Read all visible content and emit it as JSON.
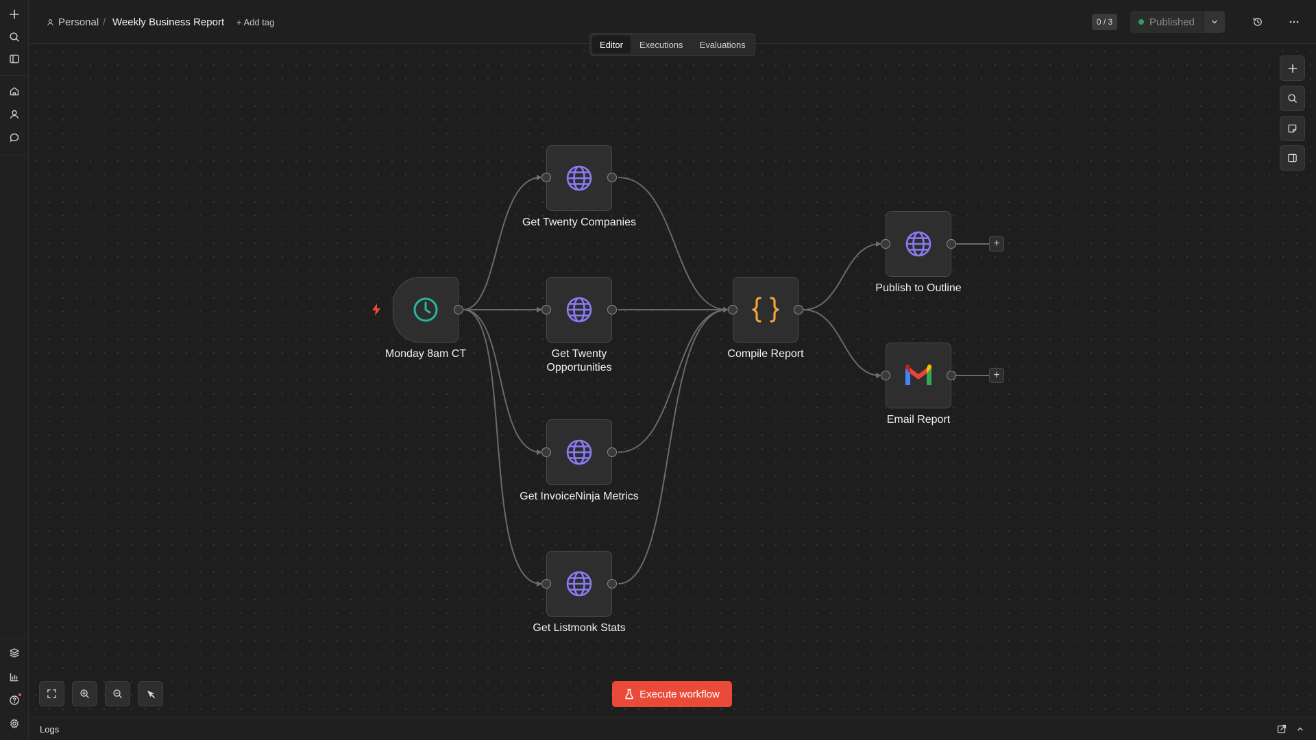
{
  "breadcrumb": {
    "owner": "Personal",
    "separator": "/",
    "workflow_name": "Weekly Business Report",
    "add_tag": "+ Add tag"
  },
  "header": {
    "counter": "0 / 3",
    "publish_label": "Published",
    "publish_status_color": "#2e9d5c"
  },
  "tabs": [
    {
      "label": "Editor",
      "active": true
    },
    {
      "label": "Executions",
      "active": false
    },
    {
      "label": "Evaluations",
      "active": false
    }
  ],
  "nodes": {
    "trigger": {
      "label": "Monday 8am CT",
      "icon": "clock-icon"
    },
    "companies": {
      "label": "Get Twenty Companies",
      "icon": "globe-icon"
    },
    "opportunities": {
      "label": "Get Twenty Opportunities",
      "icon": "globe-icon"
    },
    "invoiceninja": {
      "label": "Get InvoiceNinja Metrics",
      "icon": "globe-icon"
    },
    "listmonk": {
      "label": "Get Listmonk Stats",
      "icon": "globe-icon"
    },
    "compile": {
      "label": "Compile Report",
      "icon": "code-braces-icon"
    },
    "outline": {
      "label": "Publish to Outline",
      "icon": "globe-icon"
    },
    "email": {
      "label": "Email Report",
      "icon": "gmail-icon"
    }
  },
  "colors": {
    "accent": "#ea4b38",
    "globe": "#8b7cf6",
    "clock": "#2bb5a0",
    "code": "#f2a33a"
  },
  "actions": {
    "execute": "Execute workflow"
  },
  "logs": {
    "label": "Logs"
  }
}
